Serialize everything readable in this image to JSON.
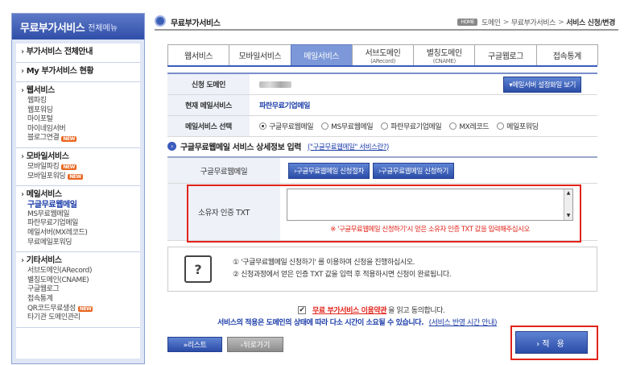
{
  "sidebar": {
    "title": "무료부가서비스",
    "title_sub": "전체메뉴",
    "sections": [
      {
        "heading": "부가서비스 전체안내",
        "items": []
      },
      {
        "heading": "My 부가서비스 현황",
        "items": []
      },
      {
        "heading": "웹서비스",
        "items": [
          {
            "label": "웹파킹",
            "new": false
          },
          {
            "label": "웹포워딩",
            "new": false
          },
          {
            "label": "마이포털",
            "new": false
          },
          {
            "label": "마이네임서버",
            "new": false
          },
          {
            "label": "블로그연결",
            "new": true
          }
        ]
      },
      {
        "heading": "모바일서비스",
        "items": [
          {
            "label": "모바일파킹",
            "new": true
          },
          {
            "label": "모바일포워딩",
            "new": true
          }
        ]
      },
      {
        "heading": "메일서비스",
        "items": [
          {
            "label": "구글무료웹메일",
            "new": false,
            "active": true
          },
          {
            "label": "MS무료웹메일",
            "new": false
          },
          {
            "label": "파란무료기업메일",
            "new": false
          },
          {
            "label": "메일서버(MX레코드)",
            "new": false
          },
          {
            "label": "무료메일포워딩",
            "new": false
          }
        ]
      },
      {
        "heading": "기타서비스",
        "items": [
          {
            "label": "서브도메인(ARecord)",
            "new": false
          },
          {
            "label": "별칭도메인(CNAME)",
            "new": false
          },
          {
            "label": "구글웹로그",
            "new": false
          },
          {
            "label": "접속통계",
            "new": false
          },
          {
            "label": "QR코드무료생성",
            "new": true
          },
          {
            "label": "타기관 도메인관리",
            "new": false
          }
        ]
      }
    ],
    "new_badge": "NEW"
  },
  "header": {
    "title": "무료부가서비스",
    "breadcrumb": {
      "home": "HOME",
      "items": [
        "도메인",
        "무료부가서비스"
      ],
      "current": "서비스 신청/변경"
    }
  },
  "tabs": [
    {
      "label": "웹서비스",
      "sub": ""
    },
    {
      "label": "모바일서비스",
      "sub": ""
    },
    {
      "label": "메일서비스",
      "sub": "",
      "active": true
    },
    {
      "label": "서브도메인",
      "sub": "(ARecord)"
    },
    {
      "label": "별칭도메인",
      "sub": "(CNAME)"
    },
    {
      "label": "구글웹로그",
      "sub": ""
    },
    {
      "label": "접속통계",
      "sub": ""
    }
  ],
  "form": {
    "domain_label": "신청 도메인",
    "mail_view_button": "▾메일서버 설정화일 보기",
    "current_mail_label": "현재 메일서비스",
    "current_mail_value": "파란무료기업메일",
    "select_label": "메일서비스 선택",
    "options": [
      {
        "label": "구글무료웹메일",
        "checked": true
      },
      {
        "label": "MS무료웹메일",
        "checked": false
      },
      {
        "label": "파란무료기업메일",
        "checked": false
      },
      {
        "label": "MX레코드",
        "checked": false
      },
      {
        "label": "메일포워딩",
        "checked": false
      }
    ]
  },
  "section": {
    "title": "구글무료웹메일 서비스 상세정보 입력",
    "link": "(\"구글무료웹메일\" 서비스란?)"
  },
  "detail": {
    "row1_label": "구글무료웹메일",
    "btn_manual": "›구글무료웹메일 신청절차",
    "btn_apply_google": "›구글무료웹메일 신청하기",
    "row2_label": "소유자 인증 TXT",
    "txt_value": "",
    "warning": "※ '구글무료웹메일 신청하기'시 얻은 소유자 인증 TXT 값을 입력해주십시오"
  },
  "notice": {
    "icon": "?",
    "line1": "① '구글무료웹메일 신청하기' 를 이용하여 신청을 진행하십시오.",
    "line2": "② 신청과정에서 얻은 인증 TXT 값을 입력 후 적용하시면 신청이 완료됩니다."
  },
  "agreement": {
    "terms": "무료 부가서비스 이용약관",
    "rest": "을 읽고 동의합니다.",
    "checked": true
  },
  "service_note": {
    "main": "서비스의 적용은 도메인의 상태에 따라 다소 시간이 소요될 수 있습니다.",
    "link": "(서비스 반영 시간 안내)"
  },
  "buttons": {
    "list": "»리스트",
    "back": "›뒤로가기",
    "apply": "›적 용"
  }
}
